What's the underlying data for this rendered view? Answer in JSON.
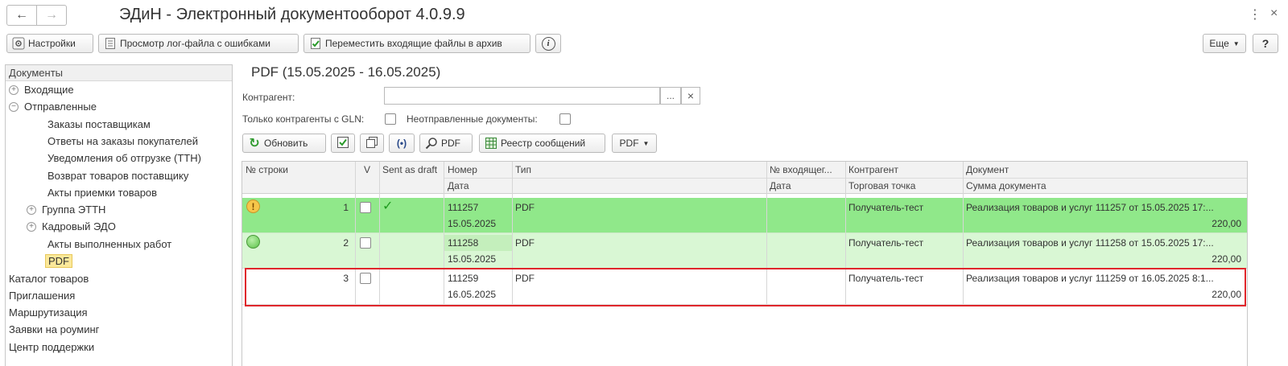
{
  "window": {
    "title": "ЭДиН - Электронный документооборот 4.0.9.9",
    "back_icon": "←",
    "forward_icon": "→",
    "more_icon": "⋮",
    "close_icon": "×"
  },
  "toolbar": {
    "settings_label": "Настройки",
    "view_log_label": "Просмотр лог-файла с ошибками",
    "move_archive_label": "Переместить входящие файлы в архив",
    "info_icon": "i",
    "more_label": "Еще",
    "help_label": "?"
  },
  "sidebar": {
    "header": "Документы",
    "items": [
      {
        "label": "Входящие",
        "expander": "+"
      },
      {
        "label": "Отправленные",
        "expander": "−"
      },
      {
        "label": "Заказы поставщикам"
      },
      {
        "label": "Ответы на заказы покупателей"
      },
      {
        "label": "Уведомления об отгрузке (ТТН)"
      },
      {
        "label": "Возврат товаров поставщику"
      },
      {
        "label": "Акты приемки товаров"
      },
      {
        "label": "Группа ЭТТН",
        "expander": "+"
      },
      {
        "label": "Кадровый ЭДО",
        "expander": "+"
      },
      {
        "label": "Акты выполненных работ"
      },
      {
        "label": "PDF"
      },
      {
        "label": "Каталог товаров"
      },
      {
        "label": "Приглашения"
      },
      {
        "label": "Маршрутизация"
      },
      {
        "label": "Заявки на роуминг"
      },
      {
        "label": "Центр поддержки"
      }
    ]
  },
  "main": {
    "title": "PDF (15.05.2025 - 16.05.2025)",
    "counterparty_label": "Контрагент:",
    "counterparty_value": "",
    "ellipsis_label": "...",
    "clear_label": "×",
    "gln_only_label": "Только контрагенты с GLN:",
    "unsent_label": "Неотправленные документы:",
    "refresh_label": "Обновить",
    "pdf_button_label": "PDF",
    "registry_label": "Реестр сообщений",
    "pdf_dropdown_label": "PDF"
  },
  "grid": {
    "headers_top": [
      "№ строки",
      "V",
      "Sent as draft",
      "Номер",
      "Тип",
      "№ входящег...",
      "Контрагент",
      "Документ"
    ],
    "headers_bottom": [
      "",
      "",
      "",
      "Дата",
      "",
      "Дата",
      "Торговая точка",
      "Сумма документа"
    ],
    "rows": [
      {
        "status": "warning",
        "num": "1",
        "sent_as_draft": "✓",
        "number": "111257",
        "date": "15.05.2025",
        "type": "PDF",
        "counterparty": "Получатель-тест",
        "document": "Реализация товаров и услуг 111257 от 15.05.2025 17:...",
        "sum": "220,00"
      },
      {
        "status": "ok",
        "num": "2",
        "sent_as_draft": "",
        "number": "111258",
        "date": "15.05.2025",
        "type": "PDF",
        "counterparty": "Получатель-тест",
        "document": "Реализация товаров и услуг 111258 от 15.05.2025 17:...",
        "sum": "220,00"
      },
      {
        "status": "none",
        "num": "3",
        "sent_as_draft": "",
        "number": "111259",
        "date": "16.05.2025",
        "type": "PDF",
        "counterparty": "Получатель-тест",
        "document": "Реализация товаров и услуг 111259 от 16.05.2025 8:1...",
        "sum": "220,00"
      }
    ]
  },
  "colors": {
    "row_warning_bg": "#90e88a",
    "row_ok_bg": "#d9f7d4",
    "highlight_border": "#e0262b",
    "selected_item_bg": "#fbe89a"
  }
}
